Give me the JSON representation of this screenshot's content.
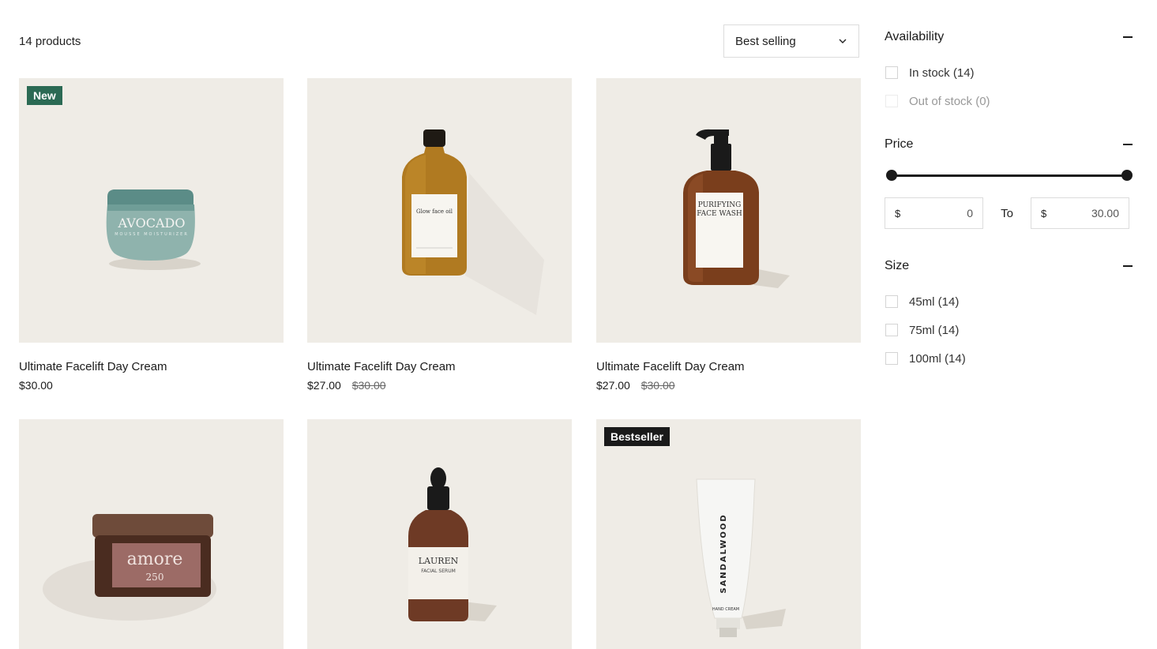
{
  "toolbar": {
    "product_count": "14 products",
    "sort_label": "Best selling"
  },
  "products": [
    {
      "title": "Ultimate Facelift Day Cream",
      "price": "$30.00",
      "compare_price": "",
      "badge": "New",
      "badge_color": "#2b6a54",
      "image": "avocado-cream-jar",
      "image_text": [
        "AVOCADO",
        "MOUSSE MOISTURIZER"
      ]
    },
    {
      "title": "Ultimate Facelift Day Cream",
      "price": "$27.00",
      "compare_price": "$30.00",
      "badge": "",
      "image": "amber-glow-face-oil-bottle",
      "image_text": [
        "Glow face oil"
      ]
    },
    {
      "title": "Ultimate Facelift Day Cream",
      "price": "$27.00",
      "compare_price": "$30.00",
      "badge": "",
      "image": "purifying-face-wash-pump",
      "image_text": [
        "PURIFYING",
        "FACE WASH"
      ]
    },
    {
      "title": "",
      "price": "",
      "compare_price": "",
      "badge": "",
      "image": "amore-tin",
      "image_text": [
        "amore",
        "250"
      ]
    },
    {
      "title": "",
      "price": "",
      "compare_price": "",
      "badge": "",
      "image": "lauren-serum-dropper",
      "image_text": [
        "LAUREN",
        "FACIAL SERUM"
      ]
    },
    {
      "title": "",
      "price": "",
      "compare_price": "",
      "badge": "Bestseller",
      "badge_color": "#1a1a1a",
      "image": "sandalwood-hand-cream-tube",
      "image_text": [
        "SANDALWOOD",
        "HAND CREAM"
      ]
    }
  ],
  "filters": {
    "availability": {
      "heading": "Availability",
      "options": [
        {
          "label": "In stock (14)",
          "disabled": false
        },
        {
          "label": "Out of stock (0)",
          "disabled": true
        }
      ]
    },
    "price": {
      "heading": "Price",
      "min_currency": "$",
      "min_value": "0",
      "to_label": "To",
      "max_currency": "$",
      "max_value": "30.00",
      "range_selected": [
        0,
        30
      ]
    },
    "size": {
      "heading": "Size",
      "options": [
        {
          "label": "45ml (14)"
        },
        {
          "label": "75ml (14)"
        },
        {
          "label": "100ml (14)"
        }
      ]
    }
  },
  "colors": {
    "image_bg": "#efece6",
    "badge_new": "#2b6a54",
    "badge_bestseller": "#1a1a1a"
  }
}
